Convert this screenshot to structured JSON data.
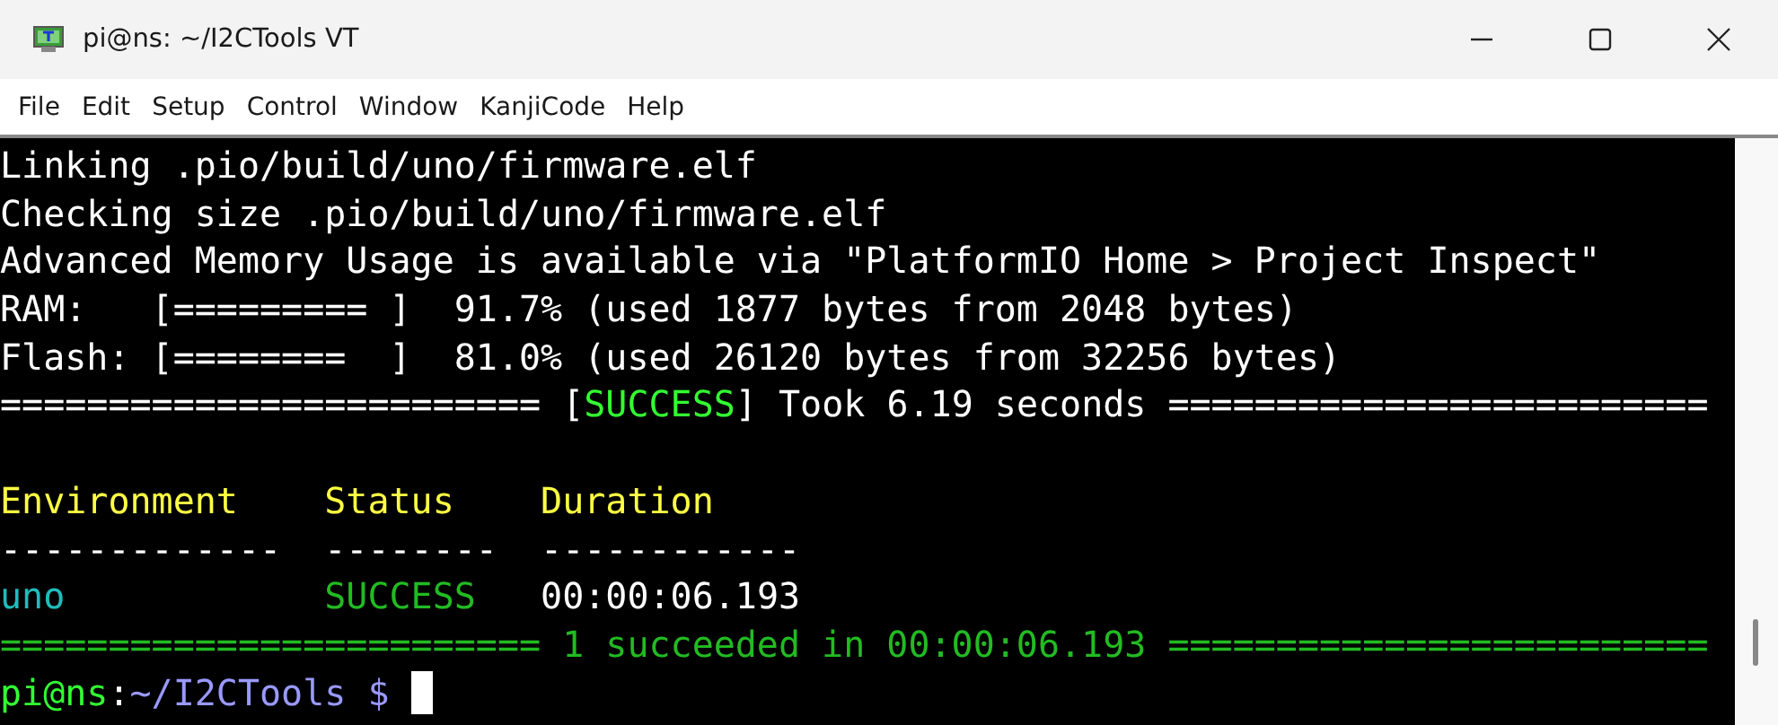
{
  "window": {
    "title": "pi@ns: ~/I2CTools VT"
  },
  "menu": [
    "File",
    "Edit",
    "Setup",
    "Control",
    "Window",
    "KanjiCode",
    "Help"
  ],
  "terminal": {
    "lines": [
      {
        "segments": [
          {
            "text": "Linking .pio/build/uno/firmware.elf",
            "color": "#ffffff"
          }
        ]
      },
      {
        "segments": [
          {
            "text": "Checking size .pio/build/uno/firmware.elf",
            "color": "#ffffff"
          }
        ]
      },
      {
        "segments": [
          {
            "text": "Advanced Memory Usage is available via \"PlatformIO Home > Project Inspect\"",
            "color": "#ffffff"
          }
        ]
      },
      {
        "segments": [
          {
            "text": "RAM:   [========= ]  91.7% (used 1877 bytes from 2048 bytes)",
            "color": "#ffffff"
          }
        ]
      },
      {
        "segments": [
          {
            "text": "Flash: [========  ]  81.0% (used 26120 bytes from 32256 bytes)",
            "color": "#ffffff"
          }
        ]
      },
      {
        "segments": [
          {
            "text": "========================= [",
            "color": "#ffffff"
          },
          {
            "text": "SUCCESS",
            "color": "#33ff33"
          },
          {
            "text": "] Took 6.19 seconds =========================",
            "color": "#ffffff"
          }
        ]
      },
      {
        "kind": "blank"
      },
      {
        "segments": [
          {
            "text": "Environment    Status    Duration",
            "color": "#ffff44"
          }
        ]
      },
      {
        "segments": [
          {
            "text": "-------------  --------  ------------",
            "color": "#ffffff"
          }
        ]
      },
      {
        "segments": [
          {
            "text": "uno",
            "color": "#22bbbb"
          },
          {
            "text": "            SUCCESS",
            "color": "#22bb22"
          },
          {
            "text": "   00:00:06.193",
            "color": "#ffffff"
          }
        ]
      },
      {
        "segments": [
          {
            "text": "========================= 1 succeeded in 00:00:06.193 =========================",
            "color": "#22bb22"
          }
        ]
      },
      {
        "segments": [
          {
            "text": "pi@ns",
            "color": "#33ff33"
          },
          {
            "text": ":",
            "color": "#ffffff"
          },
          {
            "text": "~/I2CTools $",
            "color": "#9999ff"
          }
        ],
        "cursor": true
      }
    ]
  }
}
